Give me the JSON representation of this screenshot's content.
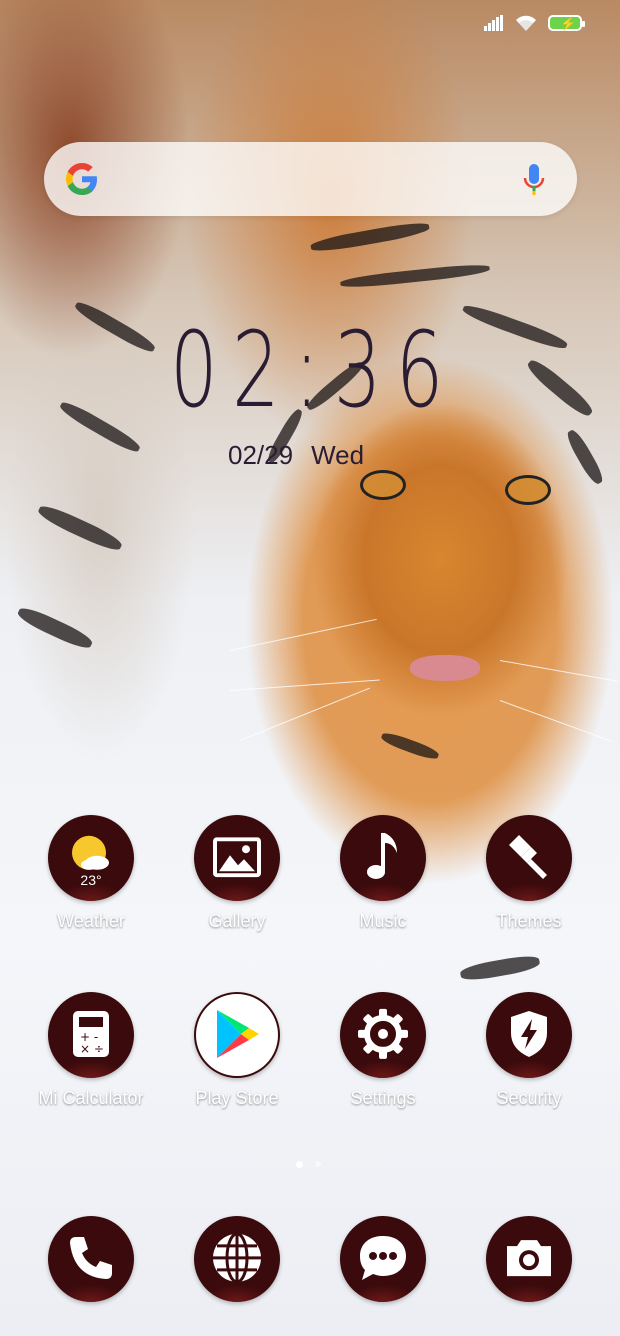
{
  "status_bar": {
    "signal": "signal-icon",
    "wifi": "wifi-icon",
    "battery": "battery-charging-icon",
    "battery_color": "#6dd34a"
  },
  "search": {
    "logo": "google-logo",
    "mic": "mic-icon"
  },
  "clock": {
    "time": "02:36",
    "date": "02/29",
    "weekday": "Wed"
  },
  "apps": [
    {
      "label": "Weather",
      "icon": "weather-sun-icon",
      "badge": "23°"
    },
    {
      "label": "Gallery",
      "icon": "gallery-icon"
    },
    {
      "label": "Music",
      "icon": "music-note-icon"
    },
    {
      "label": "Themes",
      "icon": "paintbrush-icon"
    },
    {
      "label": "Mi Calculator",
      "icon": "calculator-icon"
    },
    {
      "label": "Play Store",
      "icon": "play-store-icon"
    },
    {
      "label": "Settings",
      "icon": "gear-icon"
    },
    {
      "label": "Security",
      "icon": "shield-bolt-icon"
    }
  ],
  "dock": [
    {
      "icon": "phone-icon"
    },
    {
      "icon": "browser-globe-icon"
    },
    {
      "icon": "messages-icon"
    },
    {
      "icon": "camera-icon"
    }
  ],
  "pager": {
    "pages": 2,
    "current": 1
  },
  "colors": {
    "icon_bg": "#3a0a0c",
    "clock_text": "#2a1d33"
  }
}
